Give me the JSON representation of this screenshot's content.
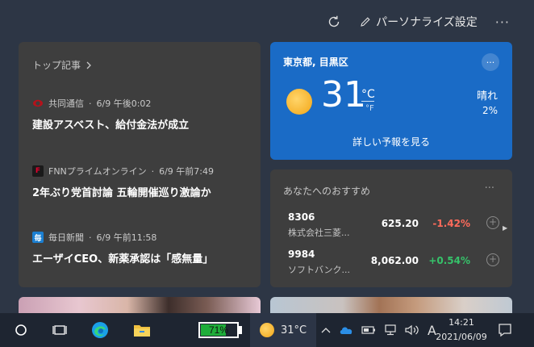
{
  "topbar": {
    "refresh_icon": "refresh-icon",
    "personalize_label": "パーソナライズ設定",
    "more_label": "···"
  },
  "news": {
    "header": "トップ記事",
    "items": [
      {
        "source": "共同通信",
        "time": "6/9 午後0:02",
        "title": "建設アスベスト、給付金法が成立",
        "logo_color": "#b5121b",
        "logo_text": ""
      },
      {
        "source": "FNNプライムオンライン",
        "time": "6/9 午前7:49",
        "title": "2年ぶり党首討論 五輪開催巡り激論か",
        "logo_color": "#e6002d",
        "logo_text": "F"
      },
      {
        "source": "毎日新聞",
        "time": "6/9 午前11:58",
        "title": "エーザイCEO、新薬承認は「感無量」",
        "logo_color": "#1b7fd1",
        "logo_text": "毎"
      }
    ]
  },
  "weather": {
    "location": "東京都, 目黒区",
    "more_label": "···",
    "temperature": "31",
    "unit_c": "°C",
    "unit_f": "°F",
    "condition": "晴れ",
    "precip": "2%",
    "link": "詳しい予報を見る",
    "accent": "#1a6bc6"
  },
  "stocks": {
    "header": "あなたへのおすすめ",
    "more_label": "···",
    "rows": [
      {
        "code": "8306",
        "name": "株式会社三菱...",
        "price": "625.20",
        "change": "-1.42%",
        "color": "#ff6b5b"
      },
      {
        "code": "9984",
        "name": "ソフトバンク...",
        "price": "8,062.00",
        "change": "+0.54%",
        "color": "#36c26a"
      }
    ],
    "next_arrow": "▶"
  },
  "taskbar": {
    "battery": "71%",
    "battery_level": 0.71,
    "weather_temp": "31°C",
    "ime_label": "A",
    "time": "14:21",
    "date": "2021/06/09"
  }
}
